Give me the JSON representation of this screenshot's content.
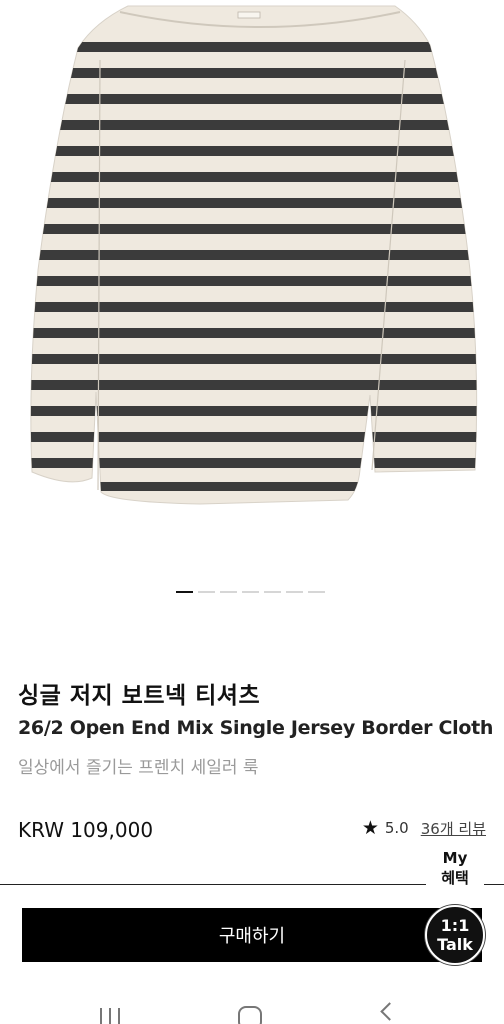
{
  "product": {
    "name_kr": "싱글 저지 보트넥 티셔츠",
    "name_en": "26/2 Open End Mix Single Jersey Border Cloth",
    "tagline": "일상에서 즐기는 프렌치 세일러 룩",
    "price": "KRW 109,000",
    "rating_score": "5.0",
    "review_count": "36개 리뷰",
    "image_count": 7,
    "active_image": 1
  },
  "colors": {
    "shirt_base": "#efe9df",
    "stripe": "#3b3b3b",
    "button_bg": "#000000"
  },
  "floating": {
    "benefit_line1": "My",
    "benefit_line2": "혜택",
    "talk_line1": "1:1",
    "talk_line2": "Talk"
  },
  "actions": {
    "buy_label": "구매하기"
  },
  "icons": {
    "star": "star-icon",
    "nav_recent": "recent-apps-icon",
    "nav_home": "home-icon",
    "nav_back": "back-icon"
  }
}
